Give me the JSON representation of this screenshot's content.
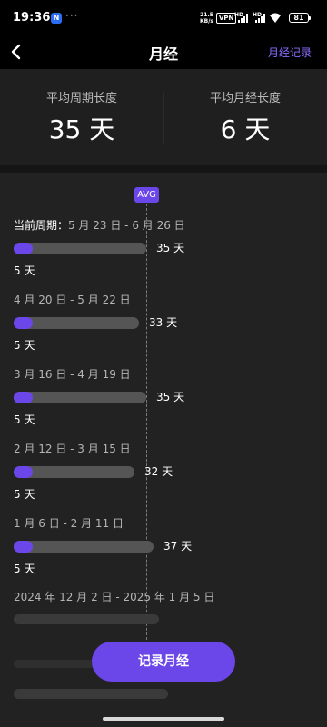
{
  "status_bar": {
    "time": "19:36",
    "app_badge": "N",
    "dots": "···",
    "net_speed_value": "21.5",
    "net_speed_unit": "KB/s",
    "vpn": "VPN",
    "hd1": "HD",
    "hd2": "HD",
    "battery": "81"
  },
  "nav": {
    "title": "月经",
    "records_link": "月经记录"
  },
  "stats": {
    "avg_cycle_label": "平均周期长度",
    "avg_cycle_value": "35 天",
    "avg_period_label": "平均月经长度",
    "avg_period_value": "6 天"
  },
  "avg_badge": "AVG",
  "colors": {
    "accent": "#6b46e8",
    "link": "#8a6cff",
    "track": "#555555"
  },
  "cycles": [
    {
      "lead": "当前周期：",
      "range": "5 月 23 日 - 6 月 26 日",
      "cycle_days": 35,
      "cycle_label": "35 天",
      "period_days": 5,
      "period_label": "5 天"
    },
    {
      "lead": "",
      "range": "4 月 20 日 - 5 月 22 日",
      "cycle_days": 33,
      "cycle_label": "33 天",
      "period_days": 5,
      "period_label": "5 天"
    },
    {
      "lead": "",
      "range": "3 月 16 日 - 4 月 19 日",
      "cycle_days": 35,
      "cycle_label": "35 天",
      "period_days": 5,
      "period_label": "5 天"
    },
    {
      "lead": "",
      "range": "2 月 12 日 - 3 月 15 日",
      "cycle_days": 32,
      "cycle_label": "32 天",
      "period_days": 5,
      "period_label": "5 天"
    },
    {
      "lead": "",
      "range": "1 月 6 日 - 2 月 11 日",
      "cycle_days": 37,
      "cycle_label": "37 天",
      "period_days": 5,
      "period_label": "5 天"
    }
  ],
  "partial_cycle_range": "2024 年 12 月 2 日 - 2025 年 1 月 5 日",
  "record_button": "记录月经",
  "chart_data": {
    "type": "bar",
    "categories": [
      "5 月 23 日 - 6 月 26 日",
      "4 月 20 日 - 5 月 22 日",
      "3 月 16 日 - 4 月 19 日",
      "2 月 12 日 - 3 月 15 日",
      "1 月 6 日 - 2 月 11 日"
    ],
    "series": [
      {
        "values": [
          35,
          33,
          35,
          32,
          37
        ]
      },
      {
        "values": [
          5,
          5,
          5,
          5,
          5
        ]
      }
    ],
    "avg_marker": 35
  }
}
